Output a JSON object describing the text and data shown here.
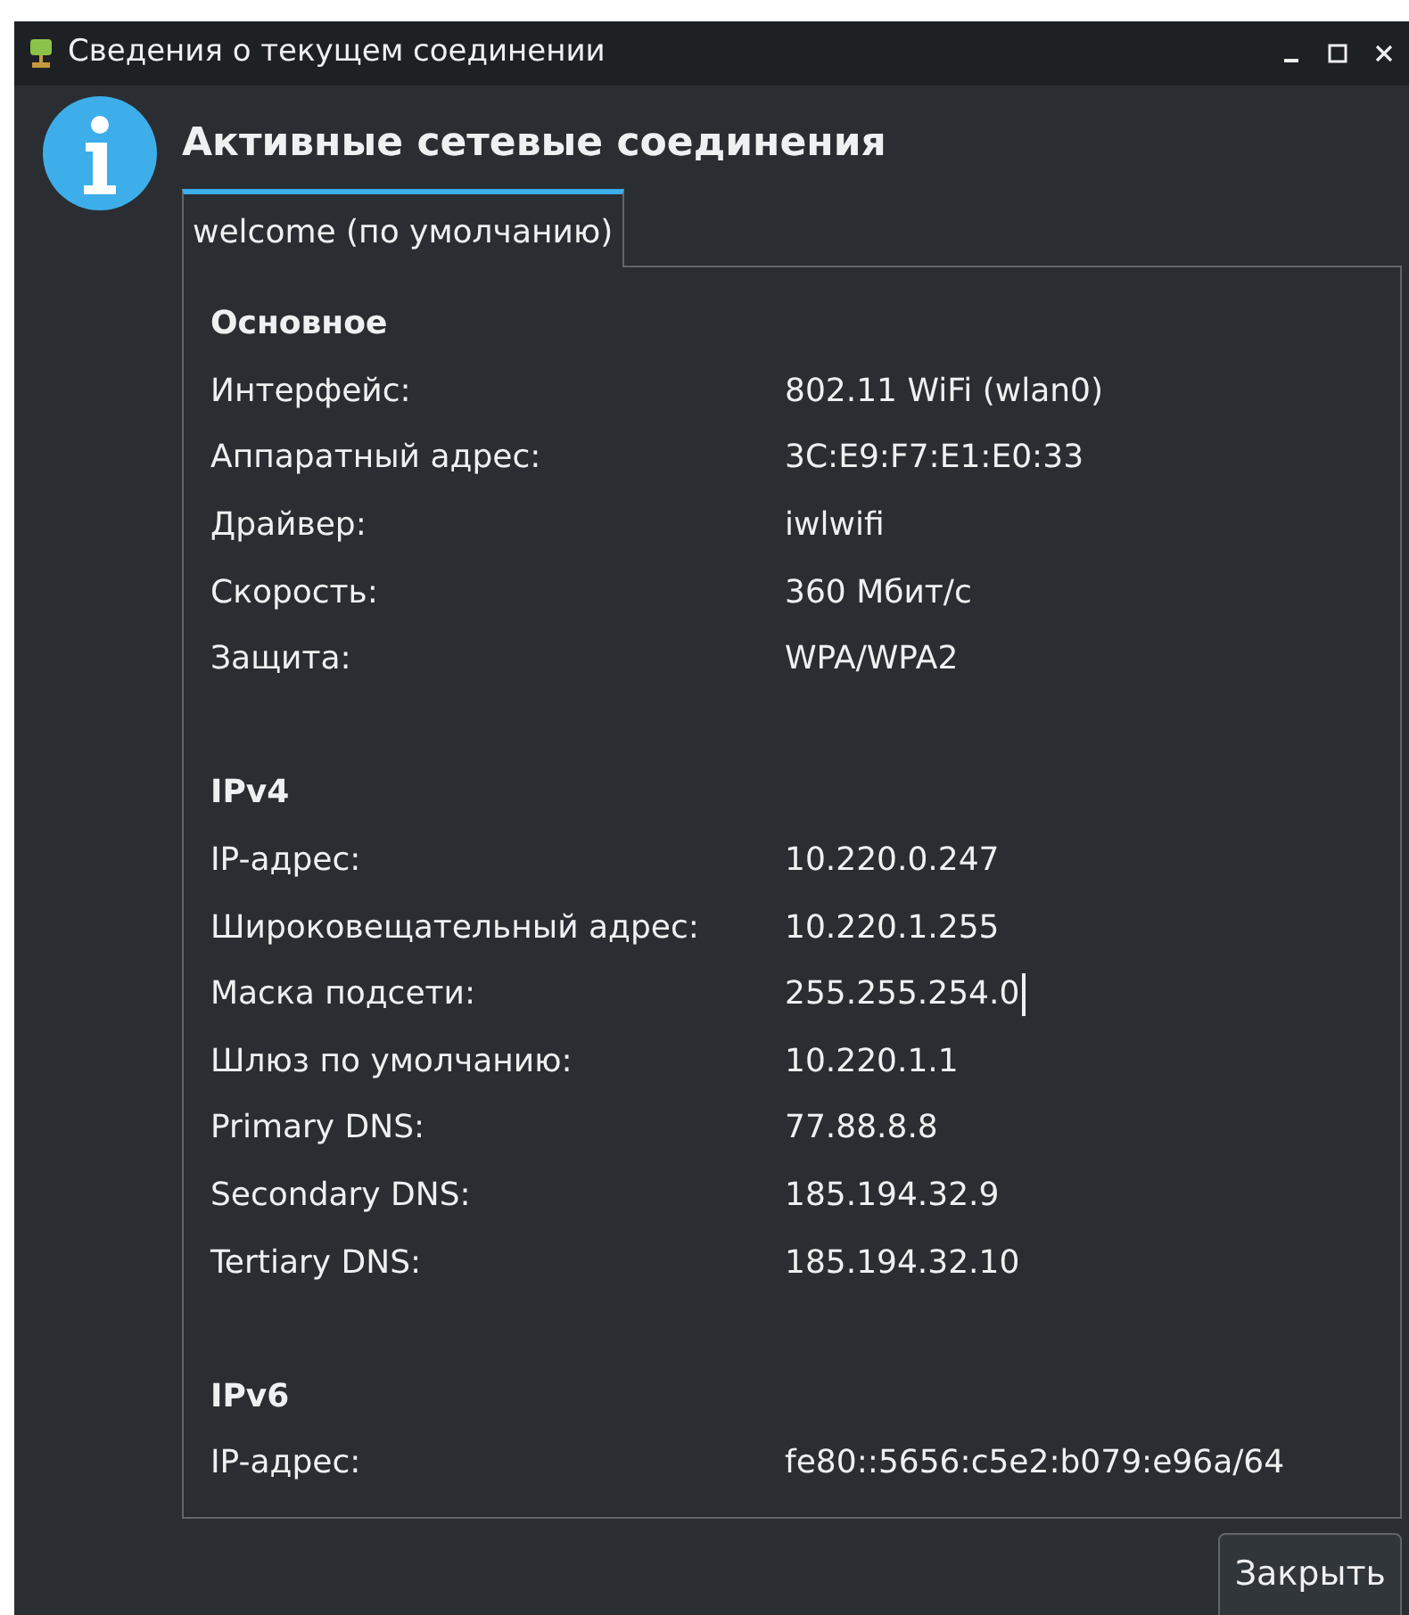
{
  "window": {
    "title": "Сведения о текущем соединении"
  },
  "heading": "Активные сетевые соединения",
  "tabs": [
    {
      "label": "welcome (по умолчанию)",
      "selected": true
    }
  ],
  "sections": [
    {
      "title": "Основное",
      "rows": [
        {
          "label": "Интерфейс:",
          "value": "802.11 WiFi (wlan0)"
        },
        {
          "label": "Аппаратный адрес:",
          "value": "3C:E9:F7:E1:E0:33"
        },
        {
          "label": "Драйвер:",
          "value": "iwlwifi"
        },
        {
          "label": "Скорость:",
          "value": "360 Мбит/с"
        },
        {
          "label": "Защита:",
          "value": "WPA/WPA2"
        }
      ]
    },
    {
      "title": "IPv4",
      "rows": [
        {
          "label": "IP-адрес:",
          "value": "10.220.0.247"
        },
        {
          "label": "Широковещательный адрес:",
          "value": "10.220.1.255"
        },
        {
          "label": "Маска подсети:",
          "value": "255.255.254.0",
          "text_cursor": true
        },
        {
          "label": "Шлюз по умолчанию:",
          "value": "10.220.1.1"
        },
        {
          "label": "Primary DNS:",
          "value": "77.88.8.8"
        },
        {
          "label": "Secondary DNS:",
          "value": "185.194.32.9"
        },
        {
          "label": "Tertiary DNS:",
          "value": "185.194.32.10"
        }
      ]
    },
    {
      "title": "IPv6",
      "rows": [
        {
          "label": "IP-адрес:",
          "value": "fe80::5656:c5e2:b079:e96a/64"
        }
      ]
    }
  ],
  "buttons": [
    "Закрыть"
  ]
}
